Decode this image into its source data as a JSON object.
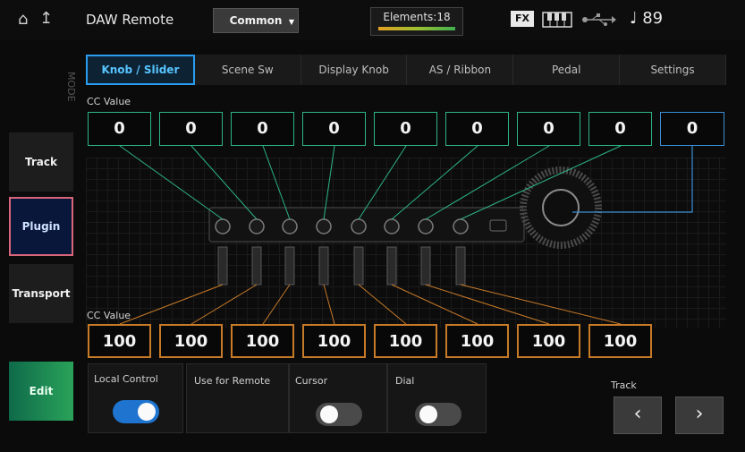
{
  "header": {
    "title": "DAW Remote",
    "common_label": "Common",
    "elements_label": "Elements:18",
    "fx_label": "FX",
    "tempo": "♩ 89"
  },
  "sidebar": {
    "mode_label": "MODE",
    "items": [
      {
        "label": "Track"
      },
      {
        "label": "Plugin"
      },
      {
        "label": "Transport"
      },
      {
        "label": "Edit"
      }
    ]
  },
  "tabs": [
    {
      "label": "Knob / Slider"
    },
    {
      "label": "Scene Sw"
    },
    {
      "label": "Display Knob"
    },
    {
      "label": "AS / Ribbon"
    },
    {
      "label": "Pedal"
    },
    {
      "label": "Settings"
    }
  ],
  "knobs": {
    "label": "CC Value",
    "values": [
      "0",
      "0",
      "0",
      "0",
      "0",
      "0",
      "0",
      "0",
      "0"
    ]
  },
  "sliders": {
    "label": "CC Value",
    "values": [
      "100",
      "100",
      "100",
      "100",
      "100",
      "100",
      "100",
      "100"
    ]
  },
  "controls": {
    "local_control_label": "Local Control",
    "local_control_on": true,
    "use_for_remote_label": "Use for Remote",
    "cursor_label": "Cursor",
    "cursor_on": false,
    "dial_label": "Dial",
    "dial_on": false,
    "track_label": "Track",
    "prev_glyph": "‹",
    "next_glyph": "›"
  },
  "colors": {
    "accent_blue": "#2a9df0",
    "knob_line": "#2db48a",
    "slider_line": "#c77a28",
    "selected_border": "#d9657a"
  }
}
